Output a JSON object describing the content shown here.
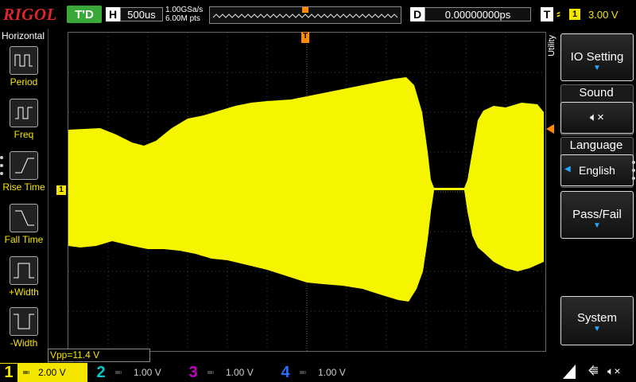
{
  "header": {
    "brand": "RIGOL",
    "trigger_status": "T'D",
    "timebase_label": "H",
    "timebase_value": "500us",
    "sample_rate": "1.00GSa/s",
    "memory_depth": "6.00M pts",
    "delay_label": "D",
    "delay_value": "0.00000000ps",
    "trigger_label": "T",
    "trigger_channel": "1",
    "trigger_level": "3.00 V"
  },
  "left_menu": {
    "title": "Horizontal",
    "items": [
      {
        "label": "Period",
        "icon": "period-icon"
      },
      {
        "label": "Freq",
        "icon": "frequency-icon"
      },
      {
        "label": "Rise Time",
        "icon": "rise-time-icon"
      },
      {
        "label": "Fall Time",
        "icon": "fall-time-icon"
      },
      {
        "label": "+Width",
        "icon": "positive-width-icon"
      },
      {
        "label": "-Width",
        "icon": "negative-width-icon"
      }
    ]
  },
  "right_menu": {
    "utility_tab": "Utility",
    "io_setting": "IO Setting",
    "sound": "Sound",
    "language_title": "Language",
    "language_value": "English",
    "pass_fail": "Pass/Fail",
    "system": "System"
  },
  "measurement": {
    "text": "Vpp=11.4 V"
  },
  "channels": [
    {
      "num": "1",
      "scale": "2.00 V",
      "color": "#f5e600"
    },
    {
      "num": "2",
      "scale": "1.00 V",
      "color": "#00c8c8"
    },
    {
      "num": "3",
      "scale": "1.00 V",
      "color": "#c800c8"
    },
    {
      "num": "4",
      "scale": "1.00 V",
      "color": "#2a6cff"
    }
  ],
  "colors": {
    "trace": "#f5f500",
    "trigger_marker": "#ff8c00"
  }
}
